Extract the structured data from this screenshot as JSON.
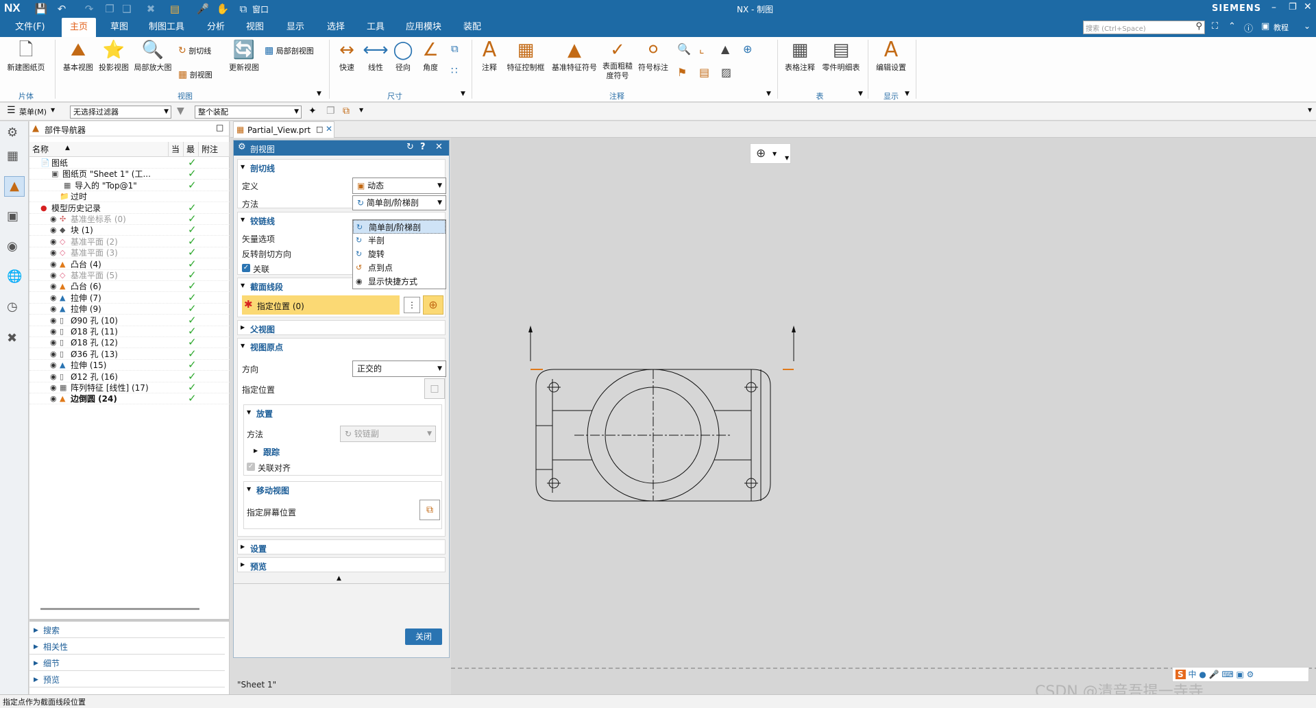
{
  "title": {
    "app_logo": "NX",
    "window_title": "NX - 制图",
    "brand": "SIEMENS",
    "window_menu": "窗口"
  },
  "menu": {
    "file": "文件(F)",
    "tabs": [
      "主页",
      "草图",
      "制图工具",
      "分析",
      "视图",
      "显示",
      "选择",
      "工具",
      "应用模块",
      "装配"
    ],
    "search_placeholder": "搜索 (Ctrl+Space)",
    "tutorial": "教程"
  },
  "ribbon": {
    "buttons": {
      "new_sheet": "新建图纸页",
      "base_view": "基本视图",
      "projected_view": "投影视图",
      "detail_view": "局部放大图",
      "section_line": "剖切线",
      "section_view": "剖视图",
      "update_view": "更新视图",
      "partial_section": "局部剖视图",
      "rapid": "快速",
      "linear": "线性",
      "radial": "径向",
      "angular": "角度",
      "note": "注释",
      "fcf": "特征控制框",
      "datum_symbol": "基准特征符号",
      "surface_finish": "表面粗糙度符号",
      "symbol_label": "符号标注",
      "table_note": "表格注释",
      "parts_list": "零件明细表",
      "edit_settings": "编辑设置"
    },
    "groups": {
      "sheet": "片体",
      "view": "视图",
      "dimension": "尺寸",
      "annotation": "注释",
      "table": "表",
      "display": "显示"
    }
  },
  "filterbar": {
    "menu": "菜单(M)",
    "filter": "无选择过滤器",
    "scope": "整个装配"
  },
  "navigator": {
    "title": "部件导航器",
    "columns": {
      "name": "名称",
      "current": "当",
      "latest": "最",
      "attach": "附注"
    },
    "rows": [
      {
        "label": "图纸",
        "style": "normal"
      },
      {
        "label": "图纸页 \"Sheet 1\" (工...",
        "style": "normal"
      },
      {
        "label": "导入的 \"Top@1\"",
        "style": "normal"
      },
      {
        "label": "过时",
        "style": "normal"
      },
      {
        "label": "模型历史记录",
        "style": "normal"
      },
      {
        "label": "基准坐标系 (0)",
        "style": "dim"
      },
      {
        "label": "块 (1)",
        "style": "normal"
      },
      {
        "label": "基准平面 (2)",
        "style": "dim"
      },
      {
        "label": "基准平面 (3)",
        "style": "dim"
      },
      {
        "label": "凸台 (4)",
        "style": "normal"
      },
      {
        "label": "基准平面 (5)",
        "style": "dim"
      },
      {
        "label": "凸台 (6)",
        "style": "normal"
      },
      {
        "label": "拉伸 (7)",
        "style": "normal"
      },
      {
        "label": "拉伸 (9)",
        "style": "normal"
      },
      {
        "label": "Ø90 孔 (10)",
        "style": "normal"
      },
      {
        "label": "Ø18 孔 (11)",
        "style": "normal"
      },
      {
        "label": "Ø18 孔 (12)",
        "style": "normal"
      },
      {
        "label": "Ø36 孔 (13)",
        "style": "normal"
      },
      {
        "label": "拉伸 (15)",
        "style": "normal"
      },
      {
        "label": "Ø12 孔 (16)",
        "style": "normal"
      },
      {
        "label": "阵列特征 [线性] (17)",
        "style": "normal"
      },
      {
        "label": "边倒圆 (24)",
        "style": "bold"
      }
    ],
    "bottom": [
      "搜索",
      "相关性",
      "细节",
      "预览"
    ]
  },
  "doc_tab": "Partial_View.prt",
  "dialog": {
    "title": "剖视图",
    "section_line": {
      "header": "剖切线",
      "define_label": "定义",
      "define_value": "动态",
      "method_label": "方法",
      "method_value": "简单剖/阶梯剖",
      "options": [
        "简单剖/阶梯剖",
        "半剖",
        "旋转",
        "点到点",
        "显示快捷方式"
      ]
    },
    "hinge_line": {
      "header": "铰链线",
      "vector": "矢量选项",
      "reverse": "反转剖切方向",
      "associative": "关联"
    },
    "cut_segment": {
      "header": "截面线段",
      "specify_location": "指定位置 (0)"
    },
    "parent_view": {
      "header": "父视图"
    },
    "view_origin": {
      "header": "视图原点",
      "orientation_label": "方向",
      "orientation_value": "正交的",
      "specify_location": "指定位置",
      "placement": {
        "header": "放置",
        "method_label": "方法",
        "method_value": "铰链副",
        "track": "跟踪",
        "assoc_align": "关联对齐"
      },
      "move_view": {
        "header": "移动视图",
        "specify_screen": "指定屏幕位置"
      }
    },
    "settings": "设置",
    "preview": "预览",
    "close_button": "关闭"
  },
  "canvas": {
    "sheet_label": "\"Sheet 1\"",
    "watermark": "CSDN @清音吾提一寺寺"
  },
  "status": {
    "message": "指定点作为截面线段位置"
  }
}
